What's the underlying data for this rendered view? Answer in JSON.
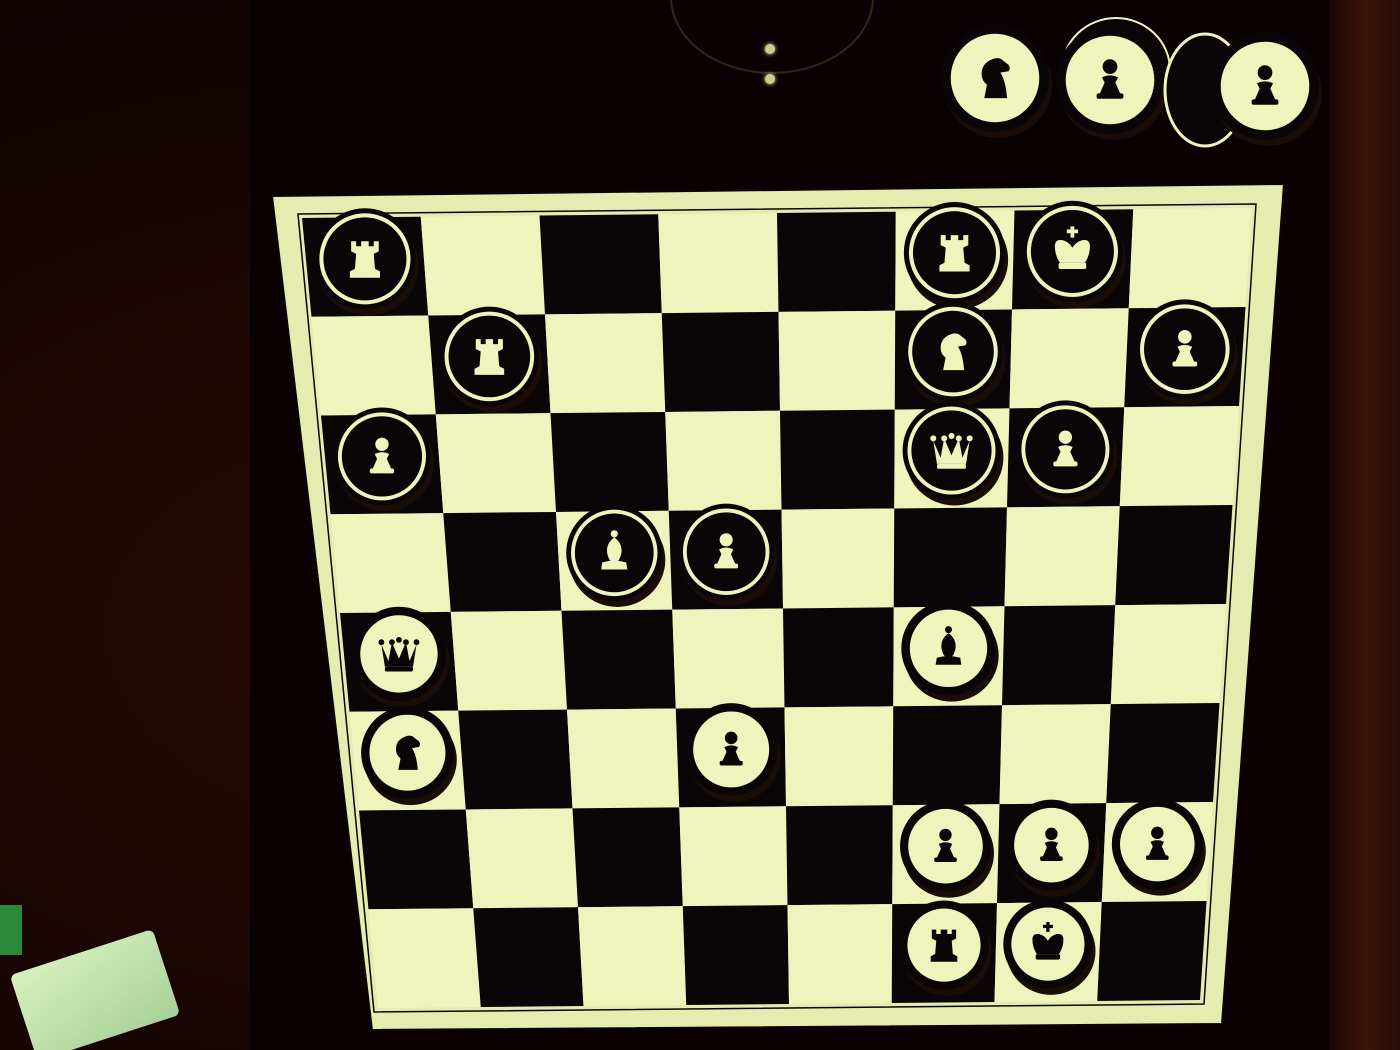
{
  "board": {
    "files": 8,
    "ranks": 8,
    "light_color": "#eef4bc",
    "dark_color": "#0a0608",
    "frame_color": "#e4ecb0"
  },
  "pieces": [
    {
      "file": 0,
      "rank": 0,
      "color": "white",
      "type": "rook",
      "icon": "rook-icon"
    },
    {
      "file": 5,
      "rank": 0,
      "color": "white",
      "type": "rook",
      "icon": "rook-icon"
    },
    {
      "file": 6,
      "rank": 0,
      "color": "white",
      "type": "king",
      "icon": "king-icon"
    },
    {
      "file": 1,
      "rank": 1,
      "color": "white",
      "type": "rook",
      "icon": "rook-icon"
    },
    {
      "file": 5,
      "rank": 1,
      "color": "white",
      "type": "knight",
      "icon": "knight-icon"
    },
    {
      "file": 7,
      "rank": 1,
      "color": "white",
      "type": "pawn",
      "icon": "pawn-icon"
    },
    {
      "file": 0,
      "rank": 2,
      "color": "white",
      "type": "pawn",
      "icon": "pawn-icon"
    },
    {
      "file": 5,
      "rank": 2,
      "color": "white",
      "type": "queen",
      "icon": "queen-icon"
    },
    {
      "file": 6,
      "rank": 2,
      "color": "white",
      "type": "pawn",
      "icon": "pawn-icon"
    },
    {
      "file": 2,
      "rank": 3,
      "color": "white",
      "type": "bishop",
      "icon": "bishop-icon"
    },
    {
      "file": 3,
      "rank": 3,
      "color": "white",
      "type": "pawn",
      "icon": "pawn-icon"
    },
    {
      "file": 0,
      "rank": 4,
      "color": "black",
      "type": "queen",
      "icon": "queen-icon"
    },
    {
      "file": 5,
      "rank": 4,
      "color": "black",
      "type": "bishop",
      "icon": "bishop-icon"
    },
    {
      "file": 0,
      "rank": 5,
      "color": "black",
      "type": "knight",
      "icon": "knight-icon"
    },
    {
      "file": 3,
      "rank": 5,
      "color": "black",
      "type": "pawn",
      "icon": "pawn-icon"
    },
    {
      "file": 5,
      "rank": 6,
      "color": "black",
      "type": "pawn",
      "icon": "pawn-icon"
    },
    {
      "file": 6,
      "rank": 6,
      "color": "black",
      "type": "pawn",
      "icon": "pawn-icon"
    },
    {
      "file": 7,
      "rank": 6,
      "color": "black",
      "type": "pawn",
      "icon": "pawn-icon"
    },
    {
      "file": 5,
      "rank": 7,
      "color": "black",
      "type": "rook",
      "icon": "rook-icon"
    },
    {
      "file": 6,
      "rank": 7,
      "color": "black",
      "type": "king",
      "icon": "king-icon"
    }
  ],
  "captured": [
    {
      "color": "black",
      "type": "knight",
      "icon": "knight-icon"
    },
    {
      "color": "black",
      "type": "pawn",
      "icon": "pawn-icon"
    },
    {
      "color": "black",
      "type": "pawn",
      "icon": "pawn-icon"
    }
  ]
}
